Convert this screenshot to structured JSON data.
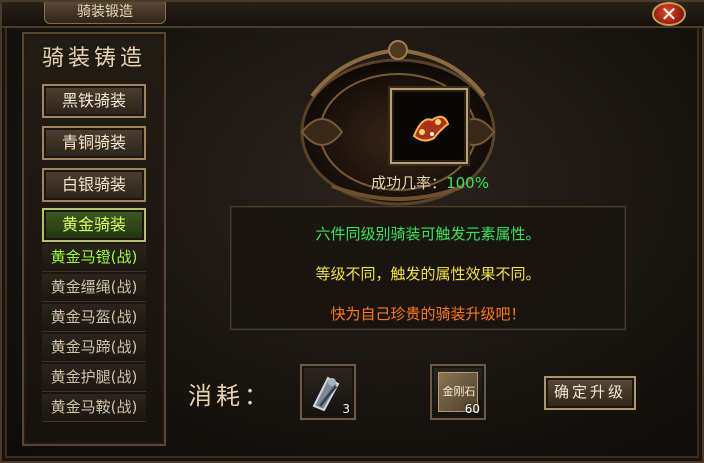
{
  "window": {
    "title": "骑装锻造",
    "close_icon": "✕"
  },
  "sidebar": {
    "title": "骑装铸造",
    "categories": [
      {
        "label": "黑铁骑装",
        "active": false
      },
      {
        "label": "青铜骑装",
        "active": false
      },
      {
        "label": "白银骑装",
        "active": false
      },
      {
        "label": "黄金骑装",
        "active": true
      }
    ],
    "sub_items": [
      {
        "label": "黄金马镫(战)",
        "selected": true
      },
      {
        "label": "黄金缰绳(战)",
        "selected": false
      },
      {
        "label": "黄金马盔(战)",
        "selected": false
      },
      {
        "label": "黄金马蹄(战)",
        "selected": false
      },
      {
        "label": "黄金护腿(战)",
        "selected": false
      },
      {
        "label": "黄金马鞍(战)",
        "selected": false
      }
    ]
  },
  "main": {
    "item_icon": "golden-stirrup-icon",
    "success_label": "成功几率：",
    "success_value": "100%",
    "info_lines": [
      {
        "text": "六件同级别骑装可触发元素属性。",
        "color": "#3fe35a"
      },
      {
        "text": "等级不同，触发的属性效果不同。",
        "color": "#f0e24a"
      },
      {
        "text": "快为自己珍贵的骑装升级吧！",
        "color": "#ff7a1a"
      }
    ],
    "cost_label": "消耗：",
    "materials": [
      {
        "icon": "stirrup-material-icon",
        "count": "3"
      },
      {
        "icon": "diamond-stone-icon",
        "name": "金刚石",
        "count": "60"
      }
    ],
    "upgrade_button": "确定升级"
  }
}
